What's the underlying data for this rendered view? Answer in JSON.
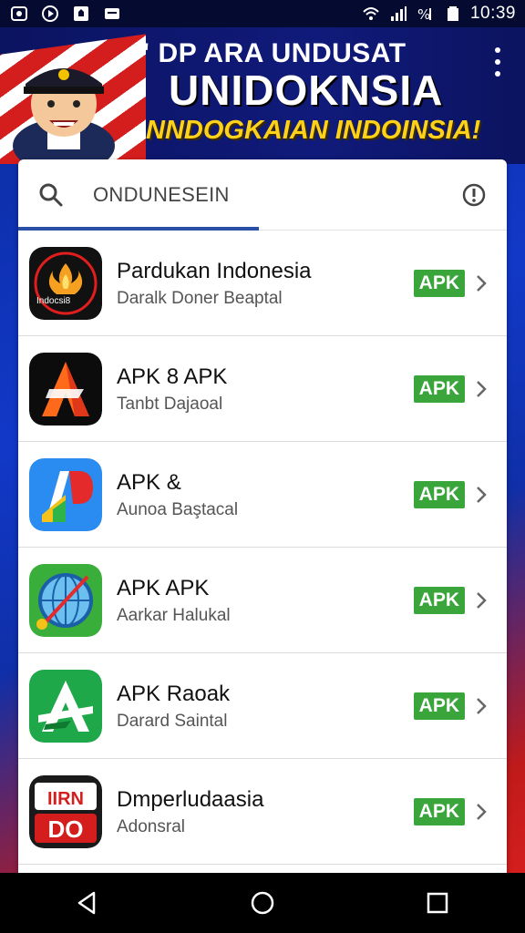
{
  "status_bar": {
    "time": "10:39",
    "icons": [
      "gallery-icon",
      "media-icon",
      "shop-icon",
      "message-icon",
      "wifi-icon",
      "signal-icon",
      "signal-percent-icon",
      "battery-icon"
    ]
  },
  "banner": {
    "line1": "\" DP ARA UNDUSAT",
    "line2": "UNIDOKNSIA",
    "line3": "NNDOGKAIAN INDOINSIA!",
    "mascot": "mascot-icon",
    "flag_colors": [
      "#d41e1e",
      "#ffffff"
    ]
  },
  "search": {
    "text": "ONDUNESEIN"
  },
  "apps": [
    {
      "name": "Pardukan Indonesia",
      "subtitle": "Daralk Doner Beaptal",
      "badge": "APK",
      "icon": "pardukan-app-icon"
    },
    {
      "name": "APK 8 APK",
      "subtitle": "Tanbt Dajaoal",
      "badge": "APK",
      "icon": "apk-8-app-icon"
    },
    {
      "name": "APK &",
      "subtitle": "Aunoa Baştacal",
      "badge": "APK",
      "icon": "apk-and-app-icon"
    },
    {
      "name": "APK APK",
      "subtitle": "Aarkar Halukal",
      "badge": "APK",
      "icon": "apk-apk-app-icon"
    },
    {
      "name": "APK Raoak",
      "subtitle": "Darard Saintal",
      "badge": "APK",
      "icon": "apk-raoak-app-icon"
    },
    {
      "name": "Dmperludaasia",
      "subtitle": "Adonsral",
      "badge": "APK",
      "icon": "dmperludaasia-app-icon"
    }
  ],
  "dmper_icon_text": {
    "top": "IIRN",
    "bottom": "DO"
  },
  "pardukan_icon_text": "Indocsi8",
  "colors": {
    "accent": "#2a4fa8",
    "apk_badge": "#3aa53a",
    "banner_yellow": "#ffd21a"
  },
  "nav": [
    "back-icon",
    "home-icon",
    "recents-icon"
  ]
}
